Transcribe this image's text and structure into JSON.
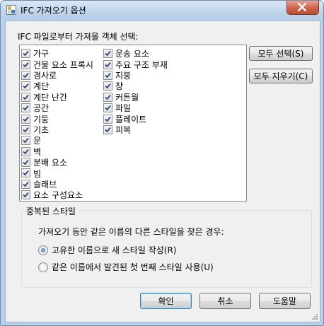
{
  "window": {
    "title": "IFC 가져오기 옵션"
  },
  "caption": "IFC 파일로부터 가져올 객체 선택:",
  "objects_col1": [
    {
      "label": "가구",
      "checked": true
    },
    {
      "label": "건물 요소 프록시",
      "checked": true
    },
    {
      "label": "경사로",
      "checked": true
    },
    {
      "label": "계단",
      "checked": true
    },
    {
      "label": "계단 난간",
      "checked": true
    },
    {
      "label": "공간",
      "checked": true
    },
    {
      "label": "기둥",
      "checked": true
    },
    {
      "label": "기초",
      "checked": true
    },
    {
      "label": "문",
      "checked": true
    },
    {
      "label": "벽",
      "checked": true
    },
    {
      "label": "분배 요소",
      "checked": true
    },
    {
      "label": "빔",
      "checked": true
    },
    {
      "label": "슬래브",
      "checked": true
    },
    {
      "label": "요소 구성요소",
      "checked": true
    }
  ],
  "objects_col2": [
    {
      "label": "운송 요소",
      "checked": true
    },
    {
      "label": "주요 구조 부재",
      "checked": true
    },
    {
      "label": "지붕",
      "checked": true
    },
    {
      "label": "창",
      "checked": true
    },
    {
      "label": "커튼월",
      "checked": true
    },
    {
      "label": "파일",
      "checked": true
    },
    {
      "label": "플레이트",
      "checked": true
    },
    {
      "label": "피복",
      "checked": true
    }
  ],
  "buttons": {
    "select_all": "모두 선택(S)",
    "clear_all": "모두 지우기(C)",
    "ok": "확인",
    "cancel": "취소",
    "help": "도움말"
  },
  "duplicate_styles": {
    "legend": "중복된 스타일",
    "question": "가져오기 동안 같은 이름의 다른 스타일을 찾은 경우:",
    "options": [
      {
        "label": "고유한 이름으로 새 스타일 작성(R)",
        "selected": true
      },
      {
        "label": "같은 이름에서 발견된 첫 번째 스타일 사용(U)",
        "selected": false
      }
    ]
  }
}
